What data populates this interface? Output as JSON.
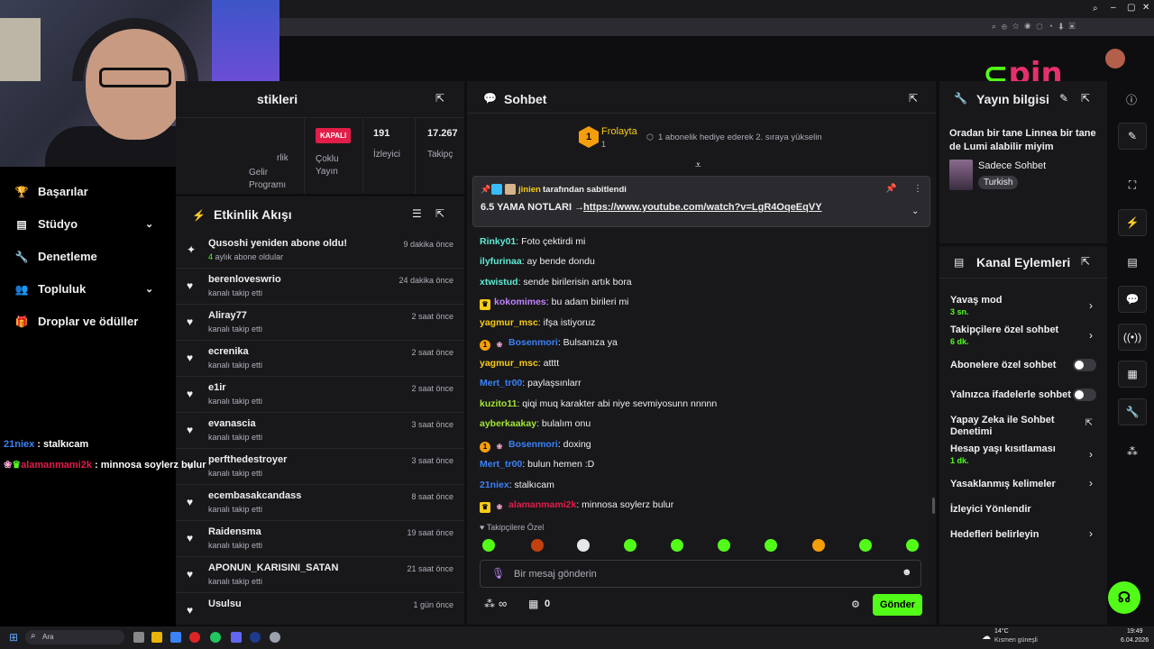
{
  "browser": {
    "title": ""
  },
  "sidebar": {
    "items": [
      {
        "label": "Başarılar",
        "icon": "trophy-icon"
      },
      {
        "label": "Stüdyo",
        "icon": "studio-icon"
      },
      {
        "label": "Denetleme",
        "icon": "wrench-icon"
      },
      {
        "label": "Topluluk",
        "icon": "people-icon"
      },
      {
        "label": "Droplar ve ödüller",
        "icon": "gift-icon"
      }
    ]
  },
  "overlay_chat": [
    {
      "user": "21niex",
      "text": " : stalkıcam",
      "color": "#3b82f6"
    },
    {
      "user": "alamanmami2k",
      "text": " : minnosa soylerz bulur",
      "color": "#e11d48"
    }
  ],
  "stats": {
    "title": "stikleri",
    "col1": "rlik",
    "col1b": "Gelir\nProgramı",
    "kapali": "KAPALI",
    "multi": "Çoklu\nYayın",
    "viewers_val": "191",
    "viewers_label": "İzleyici",
    "followers_val": "17.267",
    "followers_label": "Takipç"
  },
  "activity": {
    "title": "Etkinlik Akışı",
    "items": [
      {
        "name": "Qusoshi yeniden abone oldu!",
        "sub": "4 aylık abone oldular",
        "time": "9 dakika önce",
        "type": "sub"
      },
      {
        "name": "berenloveswrio",
        "sub": "kanalı takip etti",
        "time": "24 dakika önce",
        "type": "follow"
      },
      {
        "name": "Aliray77",
        "sub": "kanalı takip etti",
        "time": "2 saat önce",
        "type": "follow"
      },
      {
        "name": "ecrenika",
        "sub": "kanalı takip etti",
        "time": "2 saat önce",
        "type": "follow"
      },
      {
        "name": "e1ir",
        "sub": "kanalı takip etti",
        "time": "2 saat önce",
        "type": "follow"
      },
      {
        "name": "evanascia",
        "sub": "kanalı takip etti",
        "time": "3 saat önce",
        "type": "follow"
      },
      {
        "name": "perfthedestroyer",
        "sub": "kanalı takip etti",
        "time": "3 saat önce",
        "type": "follow"
      },
      {
        "name": "ecembasakcandass",
        "sub": "kanalı takip etti",
        "time": "8 saat önce",
        "type": "follow"
      },
      {
        "name": "Raidensma",
        "sub": "kanalı takip etti",
        "time": "19 saat önce",
        "type": "follow"
      },
      {
        "name": "APONUN_KARISINI_SATAN",
        "sub": "kanalı takip etti",
        "time": "21 saat önce",
        "type": "follow"
      },
      {
        "name": "Usulsu",
        "sub": "",
        "time": "1 gün önce",
        "type": "follow"
      }
    ]
  },
  "chat": {
    "title": "Sohbet",
    "gifter_name": "Frolayta",
    "gifter_count": "1",
    "gift_text": "1 abonelik hediye ederek 2. sıraya yükselin",
    "pinned_by_user": "jinien",
    "pinned_by_text": "tarafından sabitlendi",
    "pinned_text": "6.5 YAMA NOTLARI → ",
    "pinned_link": "https://www.youtube.com/watch?v=LgR4OqeEqVY",
    "messages": [
      {
        "user": "Rinky01",
        "color": "#5eead4",
        "text": ": Foto çektirdi mi",
        "badges": ""
      },
      {
        "user": "ilyfurinaa",
        "color": "#5eead4",
        "text": ": ay bende dondu",
        "badges": ""
      },
      {
        "user": "xtwistud",
        "color": "#5eead4",
        "text": ": sende birilerisin artık bora",
        "badges": ""
      },
      {
        "user": "kokomimes",
        "color": "#c084fc",
        "text": ": bu adam birileri mi",
        "badges": "crown"
      },
      {
        "user": "yagmur_msc",
        "color": "#facc15",
        "text": ": ifşa istiyoruz",
        "badges": ""
      },
      {
        "user": "Bosenmori",
        "color": "#3b82f6",
        "text": ": Bulsanıza ya",
        "badges": "one-bunny"
      },
      {
        "user": "yagmur_msc",
        "color": "#facc15",
        "text": ": atttt",
        "badges": ""
      },
      {
        "user": "Mert_tr00",
        "color": "#3b82f6",
        "text": ": paylaşsınlarr",
        "badges": ""
      },
      {
        "user": "kuzito11",
        "color": "#a3e635",
        "text": ": qiqi muq karakter abi niye sevmiyosunn nnnnn",
        "badges": ""
      },
      {
        "user": "ayberkaakay",
        "color": "#a3e635",
        "text": ": bulalım onu",
        "badges": ""
      },
      {
        "user": "Bosenmori",
        "color": "#3b82f6",
        "text": ": doxing",
        "badges": "one-bunny"
      },
      {
        "user": "Mert_tr00",
        "color": "#3b82f6",
        "text": ": bulun hemen :D",
        "badges": ""
      },
      {
        "user": "21niex",
        "color": "#3b82f6",
        "text": ": stalkıcam",
        "badges": ""
      },
      {
        "user": "alamanmami2k",
        "color": "#e11d48",
        "text": ": minnosa soylerz bulur",
        "badges": "crown-bunny"
      }
    ],
    "followers_only": "Takipçilere Özel",
    "input_placeholder": "Bir mesaj gönderin",
    "infinity": "∞",
    "count": "0",
    "send": "Gönder"
  },
  "stream_info": {
    "title": "Yayın bilgisi",
    "stream_title": "Oradan bir tane Linnea bir tane de Lumi alabilir miyim",
    "category": "Sadece Sohbet",
    "tag": "Turkish"
  },
  "channel_actions": {
    "title": "Kanal Eylemleri",
    "slow_mode": "Yavaş mod",
    "slow_val": "3 sn.",
    "followers_chat": "Takipçilere özel sohbet",
    "followers_val": "6 dk.",
    "subs_chat": "Abonelere özel sohbet",
    "emotes_chat": "Yalnızca ifadelerle sohbet",
    "ai_mod": "Yapay Zeka ile Sohbet Denetimi",
    "age_restrict": "Hesap yaşı kısıtlaması",
    "age_val": "1 dk.",
    "banned_words": "Yasaklanmış kelimeler",
    "redirect": "İzleyici Yönlendir",
    "goals": "Hedefleri belirleyin"
  },
  "logo_text": "pin",
  "taskbar": {
    "search": "Ara",
    "weather_temp": "14°C",
    "weather_text": "Kısmen güneşli",
    "time": "19:49",
    "date": "6.04.2026"
  },
  "colors": {
    "accent": "#53fc18",
    "panel": "#18181b",
    "bg": "#0e0e10"
  }
}
